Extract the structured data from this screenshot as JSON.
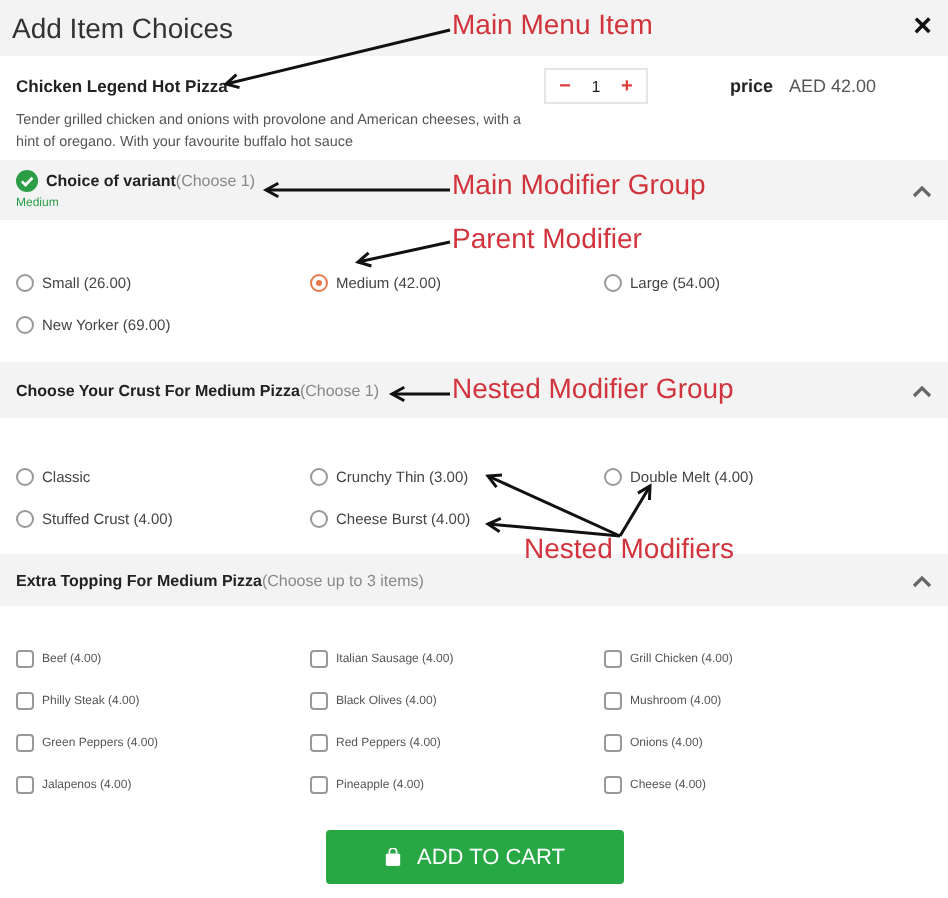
{
  "dialog": {
    "title": "Add Item Choices",
    "close": "×"
  },
  "item": {
    "name": "Chicken Legend Hot Pizza",
    "description": "Tender grilled chicken and onions with provolone and American cheeses, with a hint of oregano. With your favourite buffalo hot sauce",
    "quantity": "1",
    "minus": "−",
    "plus": "+",
    "price_label": "price",
    "price": "AED 42.00"
  },
  "groups": [
    {
      "title": "Choice of variant",
      "hint": "(Choose 1)",
      "completed": true,
      "summary": "Medium",
      "expanded": true,
      "kind": "radio",
      "options": [
        {
          "label": "Small (26.00)",
          "selected": false
        },
        {
          "label": "Medium (42.00)",
          "selected": true
        },
        {
          "label": "Large (54.00)",
          "selected": false
        },
        {
          "label": "New Yorker (69.00)",
          "selected": false
        }
      ]
    },
    {
      "title": "Choose Your Crust For Medium Pizza",
      "hint": "(Choose 1)",
      "completed": false,
      "expanded": true,
      "kind": "radio",
      "options": [
        {
          "label": "Classic",
          "selected": false
        },
        {
          "label": "Crunchy Thin (3.00)",
          "selected": false
        },
        {
          "label": "Double Melt (4.00)",
          "selected": false
        },
        {
          "label": "Stuffed Crust (4.00)",
          "selected": false
        },
        {
          "label": "Cheese Burst (4.00)",
          "selected": false
        }
      ]
    },
    {
      "title": "Extra Topping For Medium Pizza",
      "hint": "(Choose up to 3 items)",
      "completed": false,
      "expanded": true,
      "kind": "checkbox",
      "options": [
        {
          "label": "Beef (4.00)",
          "checked": false
        },
        {
          "label": "Italian Sausage (4.00)",
          "checked": false
        },
        {
          "label": "Grill Chicken (4.00)",
          "checked": false
        },
        {
          "label": "Philly Steak (4.00)",
          "checked": false
        },
        {
          "label": "Black Olives (4.00)",
          "checked": false
        },
        {
          "label": "Mushroom (4.00)",
          "checked": false
        },
        {
          "label": "Green Peppers (4.00)",
          "checked": false
        },
        {
          "label": "Red Peppers (4.00)",
          "checked": false
        },
        {
          "label": "Onions (4.00)",
          "checked": false
        },
        {
          "label": "Jalapenos (4.00)",
          "checked": false
        },
        {
          "label": "Pineapple (4.00)",
          "checked": false
        },
        {
          "label": "Cheese (4.00)",
          "checked": false
        }
      ]
    }
  ],
  "add_button": "ADD TO CART",
  "annotations": [
    {
      "text": "Main Menu Item"
    },
    {
      "text": "Main Modifier Group"
    },
    {
      "text": "Parent Modifier"
    },
    {
      "text": "Nested Modifier Group"
    },
    {
      "text": "Nested Modifiers"
    }
  ]
}
